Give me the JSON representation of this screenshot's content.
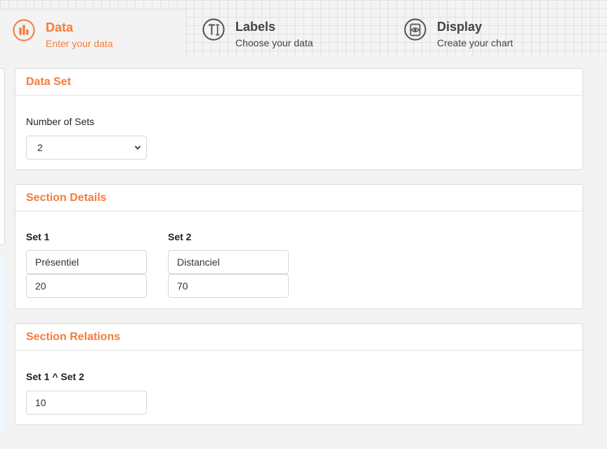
{
  "tabs": [
    {
      "title": "Data",
      "subtitle": "Enter your data",
      "icon": "bar-chart-icon",
      "active": true
    },
    {
      "title": "Labels",
      "subtitle": "Choose your data",
      "icon": "text-cursor-icon",
      "active": false
    },
    {
      "title": "Display",
      "subtitle": "Create your chart",
      "icon": "eye-icon",
      "active": false
    }
  ],
  "colors": {
    "accent": "#f47c3c",
    "icon_gray": "#555555"
  },
  "data_set": {
    "heading": "Data Set",
    "number_label": "Number of Sets",
    "number_value": "2"
  },
  "section_details": {
    "heading": "Section Details",
    "sets": [
      {
        "label": "Set 1",
        "name": "Présentiel",
        "value": "20"
      },
      {
        "label": "Set 2",
        "name": "Distanciel",
        "value": "70"
      }
    ]
  },
  "section_relations": {
    "heading": "Section Relations",
    "relation_label": "Set 1 ^ Set 2",
    "relation_value": "10"
  }
}
